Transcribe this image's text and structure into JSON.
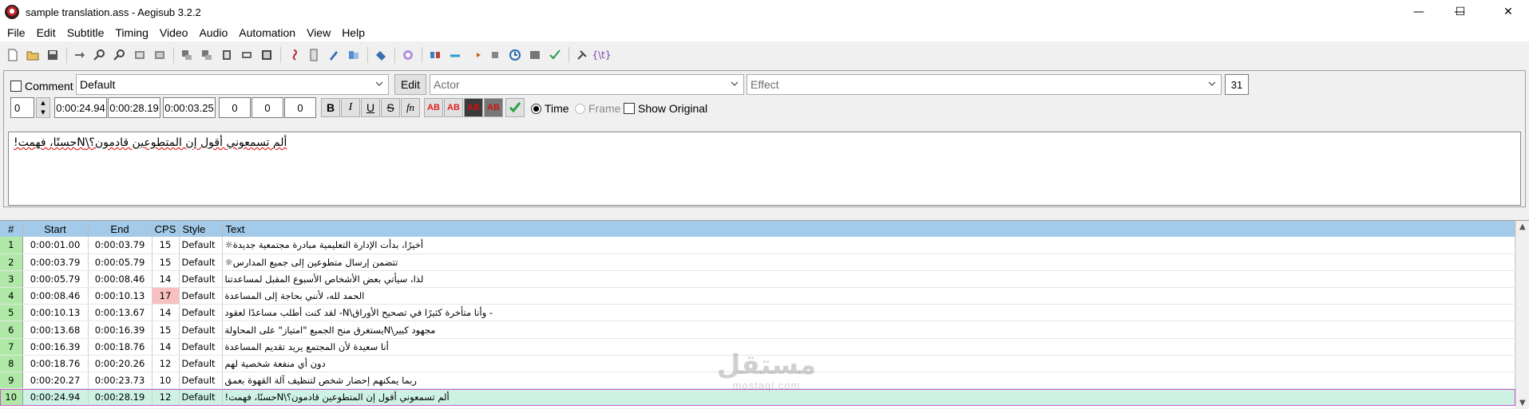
{
  "window": {
    "title": "sample translation.ass - Aegisub 3.2.2",
    "minimize": "—",
    "maximize": "☐",
    "close": "✕"
  },
  "menu": [
    "File",
    "Edit",
    "Subtitle",
    "Timing",
    "Video",
    "Audio",
    "Automation",
    "View",
    "Help"
  ],
  "editor": {
    "comment_label": "Comment",
    "style_value": "Default",
    "edit_label": "Edit",
    "actor_placeholder": "Actor",
    "effect_placeholder": "Effect",
    "char_count": "31",
    "layer": "0",
    "start_time": "0:00:24.94",
    "end_time": "0:00:28.19",
    "duration": "0:00:03.25",
    "margin_l": "0",
    "margin_r": "0",
    "margin_v": "0",
    "bold": "B",
    "italic": "I",
    "underline": "U",
    "strike": "S",
    "fn": "fn",
    "color1": "AB",
    "color2": "AB",
    "color3": "AB",
    "color4": "AB",
    "time_label": "Time",
    "frame_label": "Frame",
    "show_original_label": "Show Original",
    "text": "ألم تسمعوني أقول إن المتطوعين قادمون؟\\Nحسنًا، فهمت!"
  },
  "grid": {
    "headers": {
      "num": "#",
      "start": "Start",
      "end": "End",
      "cps": "CPS",
      "style": "Style",
      "text": "Text"
    },
    "rows": [
      {
        "num": "1",
        "start": "0:00:01.00",
        "end": "0:00:03.79",
        "cps": "15",
        "style": "Default",
        "text": "أخيرًا، بدأت الإدارة التعليمية مبادرة مجتمعية جديدة☼"
      },
      {
        "num": "2",
        "start": "0:00:03.79",
        "end": "0:00:05.79",
        "cps": "15",
        "style": "Default",
        "text": "تتضمن إرسال متطوعين إلى جميع المدارس☼"
      },
      {
        "num": "3",
        "start": "0:00:05.79",
        "end": "0:00:08.46",
        "cps": "14",
        "style": "Default",
        "text": "لذا، سيأتي بعض الأشخاص الأسبوع المقبل لمساعدتنا"
      },
      {
        "num": "4",
        "start": "0:00:08.46",
        "end": "0:00:10.13",
        "cps": "17",
        "style": "Default",
        "text": "الحمد لله، لأنني بحاجة إلى المساعدة"
      },
      {
        "num": "5",
        "start": "0:00:10.13",
        "end": "0:00:13.67",
        "cps": "14",
        "style": "Default",
        "text": "- وأنا متأخرة كثيرًا في تصحيح الأوراق\\N- لقد كنت أطلب مساعدًا لعقود"
      },
      {
        "num": "6",
        "start": "0:00:13.68",
        "end": "0:00:16.39",
        "cps": "15",
        "style": "Default",
        "text": "مجهود كبير\\Nيستغرق منح الجميع \"امتياز\" على المحاولة"
      },
      {
        "num": "7",
        "start": "0:00:16.39",
        "end": "0:00:18.76",
        "cps": "14",
        "style": "Default",
        "text": "أنا سعيدة لأن المجتمع يريد تقديم المساعدة"
      },
      {
        "num": "8",
        "start": "0:00:18.76",
        "end": "0:00:20.26",
        "cps": "12",
        "style": "Default",
        "text": "دون أي منفعة شخصية لهم"
      },
      {
        "num": "9",
        "start": "0:00:20.27",
        "end": "0:00:23.73",
        "cps": "10",
        "style": "Default",
        "text": "ربما يمكنهم إحضار شخص لتنظيف آلة القهوة بعمق"
      },
      {
        "num": "10",
        "start": "0:00:24.94",
        "end": "0:00:28.19",
        "cps": "12",
        "style": "Default",
        "text": "ألم تسمعوني أقول إن المتطوعين قادمون؟\\Nحسنًا، فهمت!"
      }
    ]
  },
  "watermark": {
    "arabic": "مستقل",
    "latin": "mostaql.com"
  }
}
